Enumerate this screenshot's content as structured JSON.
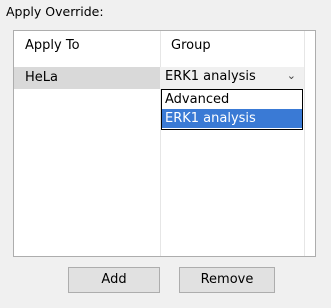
{
  "dialog": {
    "title": "Apply Override:"
  },
  "table": {
    "columns": [
      "Apply To",
      "Group"
    ],
    "rows": [
      {
        "apply_to": "HeLa",
        "group": "ERK1 analysis"
      }
    ]
  },
  "dropdown": {
    "selected": "ERK1 analysis",
    "options": [
      "Advanced",
      "ERK1 analysis"
    ],
    "arrow_icon": "chevron-down-icon"
  },
  "buttons": {
    "add": "Add",
    "remove": "Remove"
  },
  "colors": {
    "selection": "#3a7ad5",
    "row_bg": "#d9d9d9",
    "window_bg": "#f0f0f0"
  }
}
